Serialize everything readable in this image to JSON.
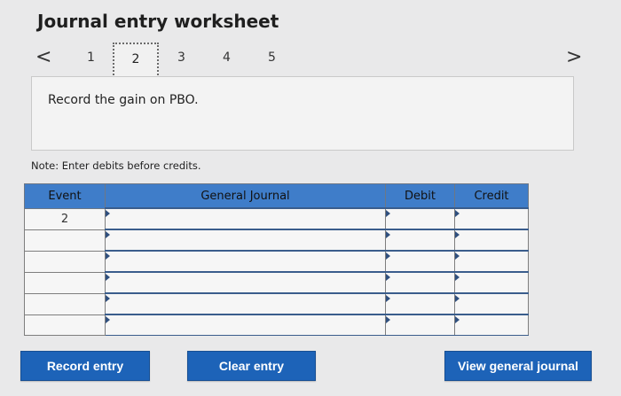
{
  "header": {
    "title": "Journal entry worksheet"
  },
  "pager": {
    "prev_icon": "chevron-left-icon",
    "next_icon": "chevron-right-icon",
    "prev_glyph": "<",
    "next_glyph": ">",
    "pages": [
      "1",
      "2",
      "3",
      "4",
      "5"
    ],
    "current": "2"
  },
  "instruction": {
    "text": "Record the gain on PBO."
  },
  "note": {
    "text": "Note: Enter debits before credits."
  },
  "journal": {
    "columns": {
      "event": "Event",
      "general_journal": "General Journal",
      "debit": "Debit",
      "credit": "Credit"
    },
    "rows": [
      {
        "event": "2",
        "account": "",
        "debit": "",
        "credit": ""
      },
      {
        "event": "",
        "account": "",
        "debit": "",
        "credit": ""
      },
      {
        "event": "",
        "account": "",
        "debit": "",
        "credit": ""
      },
      {
        "event": "",
        "account": "",
        "debit": "",
        "credit": ""
      },
      {
        "event": "",
        "account": "",
        "debit": "",
        "credit": ""
      },
      {
        "event": "",
        "account": "",
        "debit": "",
        "credit": ""
      }
    ]
  },
  "buttons": {
    "record_entry": "Record entry",
    "clear_entry": "Clear entry",
    "view_general_journal": "View general journal"
  },
  "colors": {
    "header_blue": "#3f7dc9",
    "button_blue": "#1d63b8",
    "background": "#e9e9ea"
  }
}
